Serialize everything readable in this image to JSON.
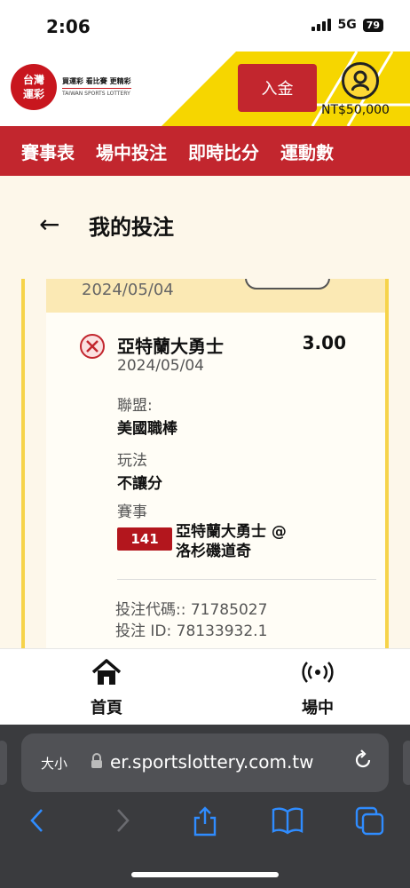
{
  "status": {
    "time": "2:06",
    "network": "5G",
    "battery": "79"
  },
  "header": {
    "logo_text": "台灣運彩",
    "tagline": "買運彩 看比賽 更精彩",
    "subtagline": "TAIWAN SPORTS LOTTERY",
    "deposit_label": "入金",
    "balance": "NT$50,000"
  },
  "nav": {
    "items": [
      "賽事表",
      "場中投注",
      "即時比分",
      "運動數"
    ]
  },
  "page": {
    "title": "我的投注",
    "back_icon": "←"
  },
  "ticket": {
    "header_date": "2024/05/04",
    "status_icon": "x-circle",
    "team": "亞特蘭大勇士",
    "odds": "3.00",
    "date": "2024/05/04",
    "league_label": "聯盟:",
    "league_value": "美國職棒",
    "play_label": "玩法",
    "play_value": "不讓分",
    "event_label": "賽事",
    "game_number": "141",
    "match_line1": "亞特蘭大勇士 @",
    "match_line2": "洛杉磯道奇",
    "bet_code": "投注代碼:: 71785027",
    "bet_id": "投注 ID: 78133932.1"
  },
  "tabbar": {
    "home_label": "首頁",
    "live_label": "場中"
  },
  "browser": {
    "text_size_label": "大小",
    "url": "er.sportslottery.com.tw",
    "colors": {
      "accent": "#2f8cff"
    }
  },
  "colors": {
    "brand_red": "#c2262e",
    "brand_yellow": "#f6d600"
  }
}
